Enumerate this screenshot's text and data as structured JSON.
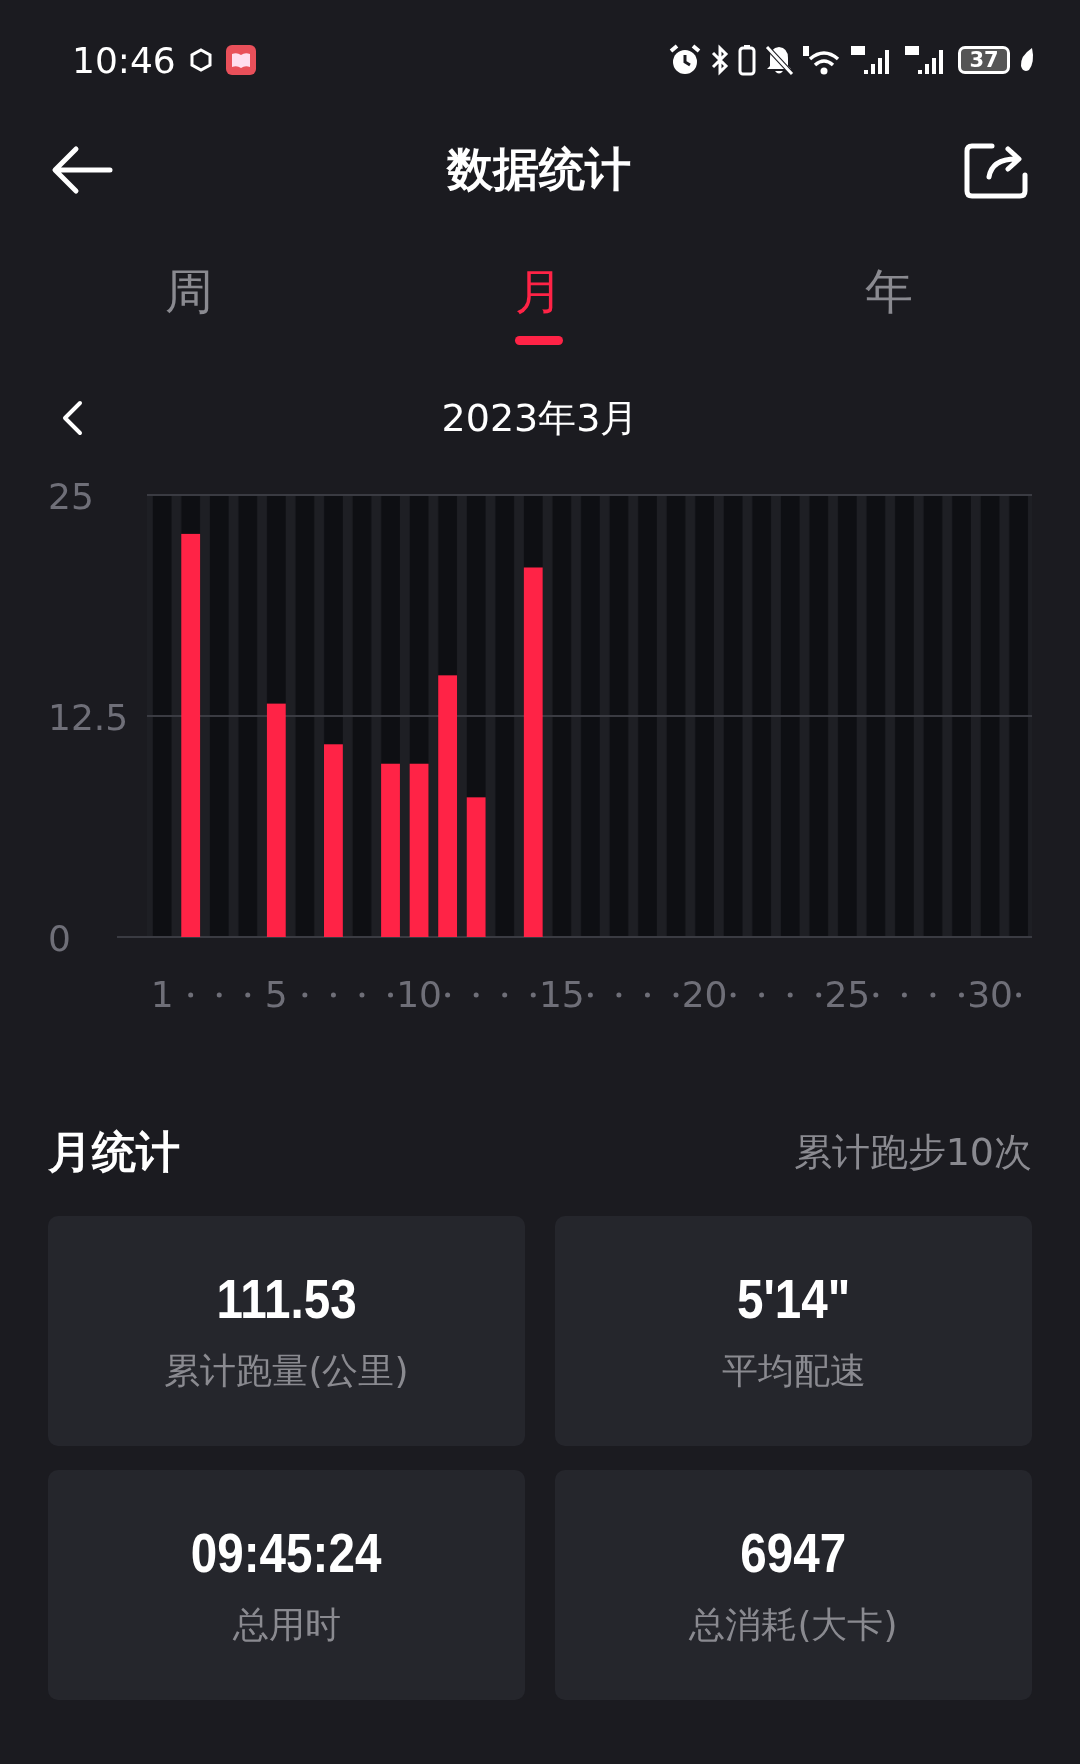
{
  "status_bar": {
    "time": "10:46",
    "battery": "37"
  },
  "header": {
    "title": "数据统计"
  },
  "tabs": [
    {
      "label": "周",
      "selected": false
    },
    {
      "label": "月",
      "selected": true
    },
    {
      "label": "年",
      "selected": false
    }
  ],
  "period": {
    "label": "2023年3月"
  },
  "chart_data": {
    "type": "bar",
    "color": "#ff2346",
    "x": [
      1,
      2,
      3,
      4,
      5,
      6,
      7,
      8,
      9,
      10,
      11,
      12,
      13,
      14,
      15,
      16,
      17,
      18,
      19,
      20,
      21,
      22,
      23,
      24,
      25,
      26,
      27,
      28,
      29,
      30,
      31
    ],
    "values": [
      0,
      22.8,
      0,
      0,
      13.2,
      0,
      10.9,
      0,
      9.8,
      9.8,
      14.8,
      7.9,
      0,
      20.9,
      0,
      0,
      0,
      0,
      0,
      0,
      0,
      0,
      0,
      0,
      0,
      0,
      0,
      0,
      0,
      0,
      0
    ],
    "xlim": [
      0.5,
      31.5
    ],
    "ylim": [
      0,
      25
    ],
    "yticks": [
      {
        "value": 0,
        "label": "0"
      },
      {
        "value": 12.5,
        "label": "12.5"
      },
      {
        "value": 25,
        "label": "25"
      }
    ],
    "xticks": [
      1,
      5,
      10,
      15,
      20,
      25,
      30
    ]
  },
  "summary": {
    "title": "月统计",
    "count": "累计跑步10次"
  },
  "stats": [
    {
      "value": "111.53",
      "label": "累计跑量(公里)"
    },
    {
      "value": "5'14\"",
      "label": "平均配速"
    },
    {
      "value": "09:45:24",
      "label": "总用时"
    },
    {
      "value": "6947",
      "label": "总消耗(大卡)"
    }
  ]
}
